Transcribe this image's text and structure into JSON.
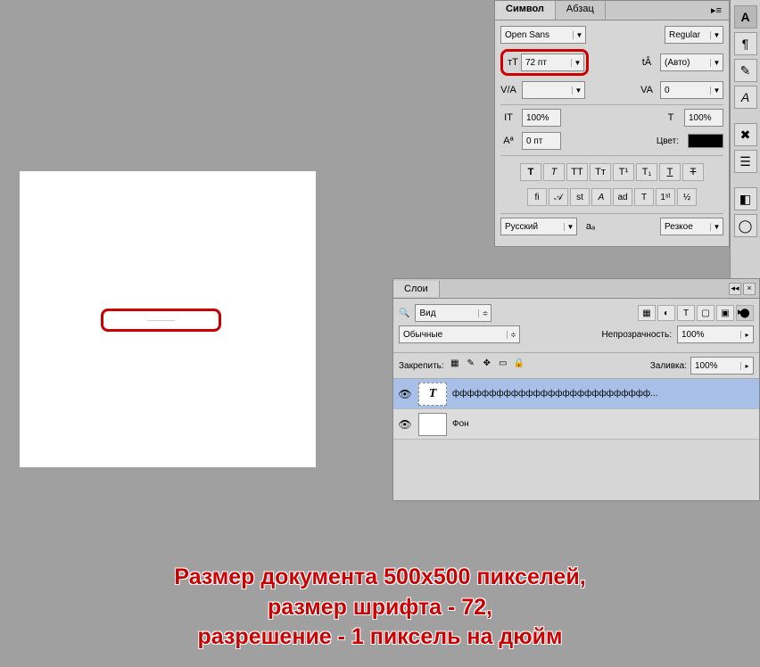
{
  "character_panel": {
    "tabs": [
      "Символ",
      "Абзац"
    ],
    "font_family": "Open Sans",
    "font_style": "Regular",
    "font_size": "72 пт",
    "leading": "(Авто)",
    "kerning": "",
    "tracking": "0",
    "vscale": "100%",
    "hscale": "100%",
    "baseline_shift": "0 пт",
    "color_label": "Цвет:",
    "language": "Русский",
    "antialias": "Резкое"
  },
  "layers_panel": {
    "tab": "Слои",
    "kind_filter": "Вид",
    "blend_mode": "Обычные",
    "opacity_label": "Непрозрачность:",
    "opacity": "100%",
    "lock_label": "Закрепить:",
    "fill_label": "Заливка:",
    "fill": "100%",
    "layers": [
      {
        "type": "text",
        "name": "ффффффффффффффффффффффффффф..."
      },
      {
        "type": "raster",
        "name": "Фон"
      }
    ]
  },
  "annotation": {
    "line1": "Размер документа 500х500 пикселей,",
    "line2": "размер шрифта - 72,",
    "line3": "разрешение - 1 пиксель на дюйм"
  },
  "canvas_text": "-------------------------------"
}
